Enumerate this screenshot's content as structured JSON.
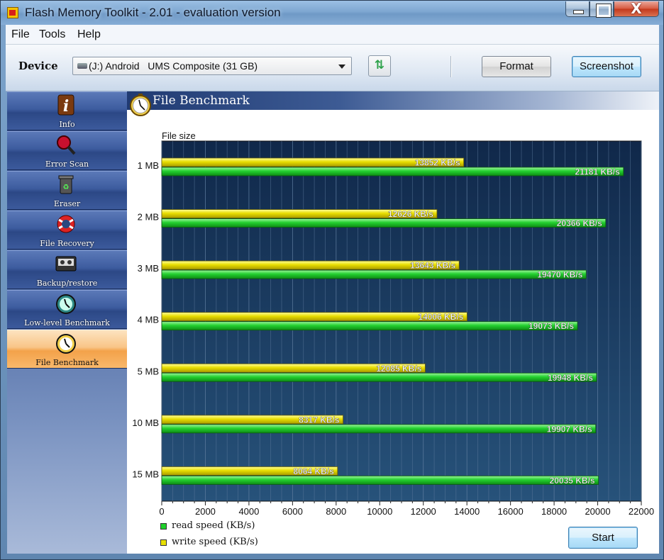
{
  "window": {
    "title": "Flash Memory Toolkit - 2.01 - evaluation version",
    "close_glyph": "X",
    "icon": "app-flash-icon"
  },
  "menu": [
    "File",
    "Tools",
    "Help"
  ],
  "toolbar": {
    "device_label": "Device",
    "device_value": "(J:) Android   UMS Composite (31 GB)",
    "refresh_icon": "refresh-icon",
    "format_label": "Format",
    "screenshot_label": "Screenshot"
  },
  "sidebar": {
    "items": [
      {
        "label": "Info",
        "icon": "info-icon"
      },
      {
        "label": "Error Scan",
        "icon": "magnifier-icon"
      },
      {
        "label": "Eraser",
        "icon": "trash-icon"
      },
      {
        "label": "File Recovery",
        "icon": "lifebuoy-icon"
      },
      {
        "label": "Backup/restore",
        "icon": "tape-icon"
      },
      {
        "label": "Low-level Benchmark",
        "icon": "stopwatch-icon"
      },
      {
        "label": "File Benchmark",
        "icon": "stopwatch-icon",
        "active": true
      }
    ]
  },
  "panel": {
    "title": "File Benchmark",
    "start_label": "Start"
  },
  "chart_data": {
    "type": "bar",
    "orientation": "horizontal",
    "ylabel": "File size",
    "categories": [
      "1 MB",
      "2 MB",
      "3 MB",
      "4 MB",
      "5 MB",
      "10 MB",
      "15 MB"
    ],
    "series": [
      {
        "name": "write speed (KB/s)",
        "color": "#e8e000",
        "values": [
          13852,
          12626,
          13643,
          14006,
          12085,
          8317,
          8064
        ],
        "labels": [
          "13852 KB/s",
          "12626 KB/s",
          "13643 KB/s",
          "14006 KB/s",
          "12085 KB/s",
          "8317 KB/s",
          "8064 KB/s"
        ]
      },
      {
        "name": "read speed (KB/s)",
        "color": "#1fd12a",
        "values": [
          21181,
          20366,
          19470,
          19073,
          19948,
          19907,
          20035
        ],
        "labels": [
          "21181 KB/s",
          "20366 KB/s",
          "19470 KB/s",
          "19073 KB/s",
          "19948 KB/s",
          "19907 KB/s",
          "20035 KB/s"
        ]
      }
    ],
    "xlim": [
      0,
      22000
    ],
    "xticks": [
      "0",
      "2000",
      "4000",
      "6000",
      "8000",
      "10000",
      "12000",
      "14000",
      "16000",
      "18000",
      "20000",
      "22000"
    ],
    "grid": true,
    "legend": [
      {
        "label": "read speed (KB/s)",
        "color": "#1fd12a"
      },
      {
        "label": "write speed (KB/s)",
        "color": "#e8e000"
      }
    ],
    "legend_position": "bottom-left",
    "background": "#1a3558"
  }
}
